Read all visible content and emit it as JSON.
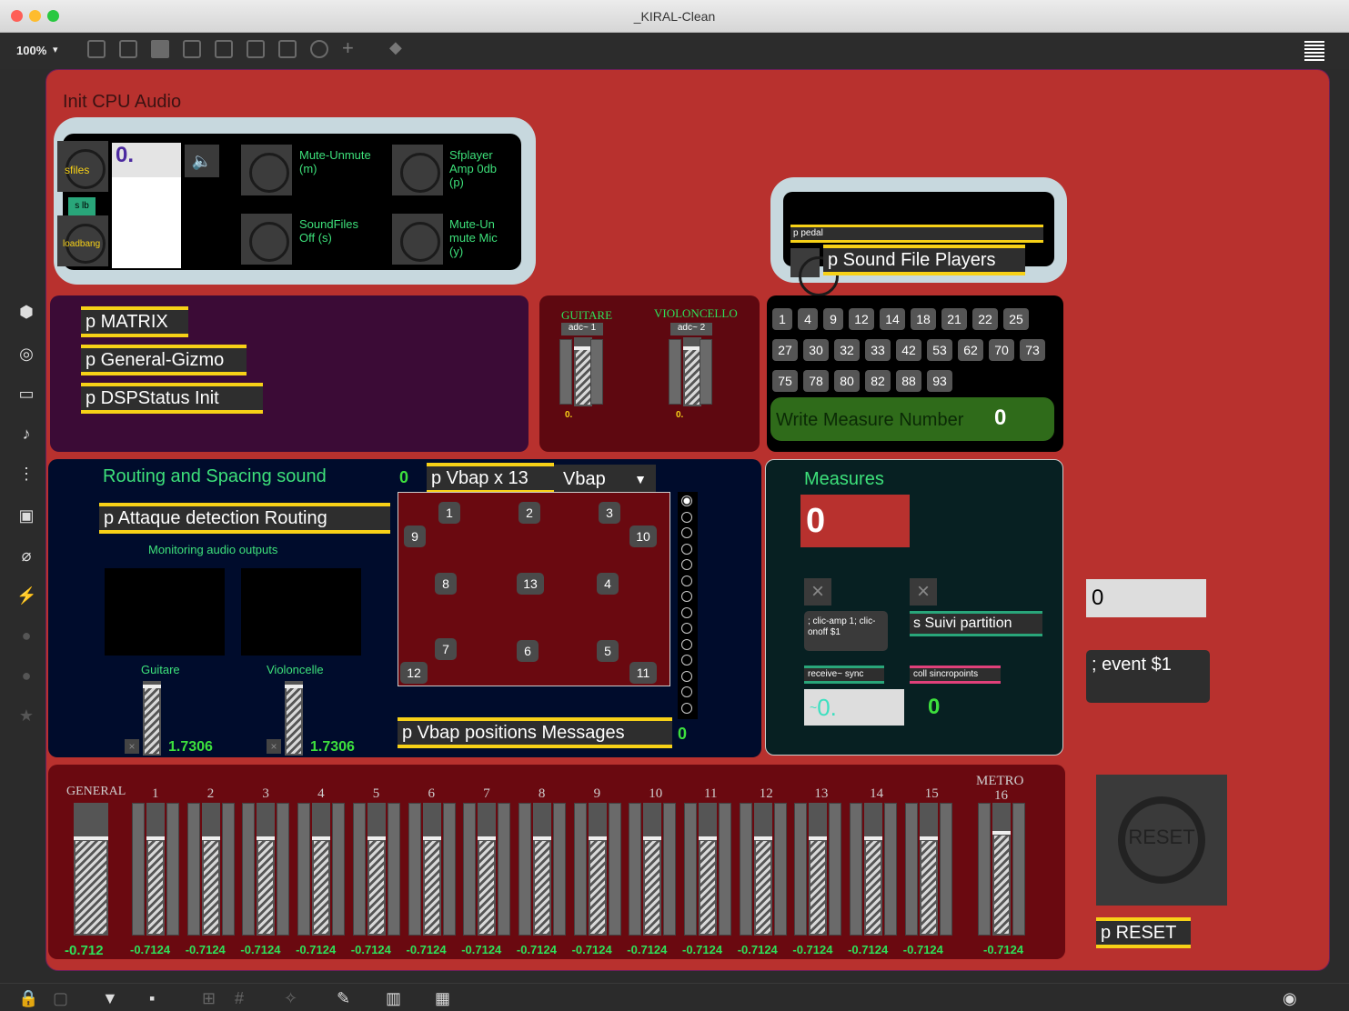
{
  "window": {
    "title": "_KIRAL-Clean"
  },
  "toolbar": {
    "zoom": "100%"
  },
  "init_panel": {
    "title": "Init CPU Audio",
    "sfiles": "sfiles",
    "slb": "s lb",
    "loadbang": "loadbang",
    "number_value": "0.",
    "mute_unmute": "Mute-Unmute (m)",
    "sfplayer_amp": "Sfplayer Amp 0db (p)",
    "soundfiles_off": "SoundFiles Off (s)",
    "mute_mic": "Mute-Un mute Mic (y)"
  },
  "sound_file_players": {
    "pedal": "p pedal",
    "label": "p Sound File Players"
  },
  "subpatchers": {
    "matrix": "p MATRIX",
    "gizmo": "p General-Gizmo",
    "dsp": "p DSPStatus Init",
    "attaque": "p Attaque detection Routing",
    "vbap_x13": "p Vbap x 13",
    "vbap_positions": "p Vbap positions Messages",
    "reset": "p RESET"
  },
  "inputs": {
    "guitare": "GUITARE",
    "violoncello": "VIOLONCELLO",
    "adc1": "adc~ 1",
    "adc2": "adc~ 2",
    "val1": "0.",
    "val2": "0."
  },
  "measure_buttons": [
    "1",
    "4",
    "9",
    "12",
    "14",
    "18",
    "21",
    "22",
    "25",
    "27",
    "30",
    "32",
    "33",
    "42",
    "53",
    "62",
    "70",
    "73",
    "75",
    "78",
    "80",
    "82",
    "88",
    "93"
  ],
  "write_measure": {
    "label": "Write Measure Number",
    "value": "0"
  },
  "routing": {
    "title": "Routing and Spacing sound",
    "value": "0",
    "vbap_menu": "Vbap",
    "monitoring": "Monitoring audio outputs",
    "guitare": "Guitare",
    "violoncelle": "Violoncelle",
    "guitare_val": "1.7306",
    "violoncelle_val": "1.7306",
    "positions_value": "0",
    "speakers": [
      "1",
      "2",
      "3",
      "4",
      "5",
      "6",
      "7",
      "8",
      "9",
      "10",
      "11",
      "12",
      "13"
    ],
    "radio_count": 14,
    "selected_radio": 0
  },
  "measures": {
    "title": "Measures",
    "value": "0",
    "message": "; clic-amp 1; clic-onoff $1",
    "send": "s Suivi partition",
    "receive": "receive~ sync",
    "coll": "coll sincropoints",
    "float_value": "0.",
    "int_value": "0"
  },
  "event": {
    "number": "0",
    "message": "; event $1"
  },
  "reset_label": "RESET",
  "mixer": {
    "general": "GENERAL",
    "general_value": "-0.712",
    "general_level": 0.72,
    "channels": [
      "1",
      "2",
      "3",
      "4",
      "5",
      "6",
      "7",
      "8",
      "9",
      "10",
      "11",
      "12",
      "13",
      "14",
      "15"
    ],
    "channel_value": "-0.7124",
    "channel_level": 0.72,
    "metro": "METRO",
    "metro_channel": "16",
    "metro_value": "-0.7124"
  },
  "colors": {
    "patch_bg": "#b8312e",
    "accent_yellow": "#f7d117",
    "number_green": "#3de03d"
  }
}
